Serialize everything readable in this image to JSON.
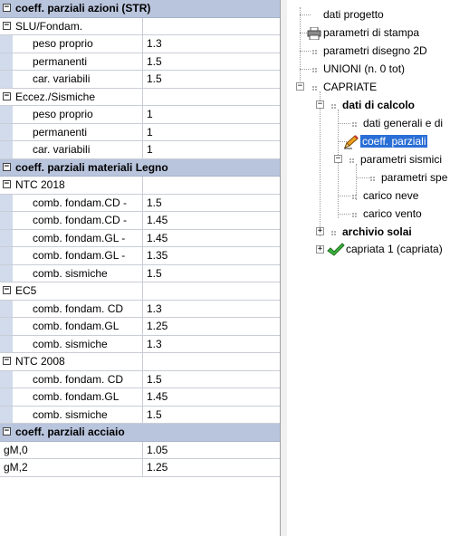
{
  "grid": {
    "rows": [
      {
        "kind": "section",
        "label": "coeff. parziali azioni (STR)",
        "value": ""
      },
      {
        "kind": "group",
        "label": "SLU/Fondam.",
        "value": ""
      },
      {
        "kind": "prop",
        "label": "peso proprio",
        "value": "1.3"
      },
      {
        "kind": "prop",
        "label": "permanenti",
        "value": "1.5"
      },
      {
        "kind": "prop",
        "label": "car. variabili",
        "value": "1.5"
      },
      {
        "kind": "group",
        "label": "Eccez./Sismiche",
        "value": ""
      },
      {
        "kind": "prop",
        "label": "peso proprio",
        "value": "1"
      },
      {
        "kind": "prop",
        "label": "permanenti",
        "value": "1"
      },
      {
        "kind": "prop",
        "label": "car. variabili",
        "value": "1"
      },
      {
        "kind": "section",
        "label": "coeff. parziali materiali Legno",
        "value": ""
      },
      {
        "kind": "group",
        "label": "NTC 2018",
        "value": ""
      },
      {
        "kind": "prop",
        "label": "comb. fondam.CD - ",
        "value": "1.5"
      },
      {
        "kind": "prop",
        "label": "comb. fondam.CD - ",
        "value": "1.45"
      },
      {
        "kind": "prop",
        "label": "comb. fondam.GL - ",
        "value": "1.45"
      },
      {
        "kind": "prop",
        "label": "comb. fondam.GL - ",
        "value": "1.35"
      },
      {
        "kind": "prop",
        "label": "comb. sismiche",
        "value": "1.5"
      },
      {
        "kind": "group",
        "label": "EC5",
        "value": ""
      },
      {
        "kind": "prop",
        "label": "comb. fondam. CD",
        "value": "1.3"
      },
      {
        "kind": "prop",
        "label": "comb. fondam.GL",
        "value": "1.25"
      },
      {
        "kind": "prop",
        "label": "comb. sismiche",
        "value": "1.3"
      },
      {
        "kind": "group",
        "label": "NTC 2008",
        "value": ""
      },
      {
        "kind": "prop",
        "label": "comb. fondam. CD",
        "value": "1.5"
      },
      {
        "kind": "prop",
        "label": "comb. fondam.GL",
        "value": "1.45"
      },
      {
        "kind": "prop",
        "label": "comb. sismiche",
        "value": "1.5"
      },
      {
        "kind": "section",
        "label": "coeff. parziali acciaio",
        "value": ""
      },
      {
        "kind": "plain",
        "label": "gM,0",
        "value": "1.05"
      },
      {
        "kind": "plain",
        "label": "gM,2",
        "value": "1.25"
      }
    ],
    "expander_symbol": "⊟"
  },
  "tree": {
    "nodes": [
      {
        "label": "dati progetto"
      },
      {
        "label": "parametri di stampa",
        "icon": "printer-icon"
      },
      {
        "label": "parametri disegno 2D"
      },
      {
        "label": "UNIONI (n. 0 tot)"
      },
      {
        "label": "CAPRIATE"
      },
      {
        "label": "dati di calcolo"
      },
      {
        "label": "dati generali e di"
      },
      {
        "label": "coeff. parziali",
        "icon": "pencil-icon"
      },
      {
        "label": "parametri sismici"
      },
      {
        "label": "parametri spe"
      },
      {
        "label": "carico neve"
      },
      {
        "label": "carico vento"
      },
      {
        "label": "archivio solai"
      },
      {
        "label": "capriata 1 (capriata)",
        "icon": "checkmark-icon"
      }
    ]
  }
}
